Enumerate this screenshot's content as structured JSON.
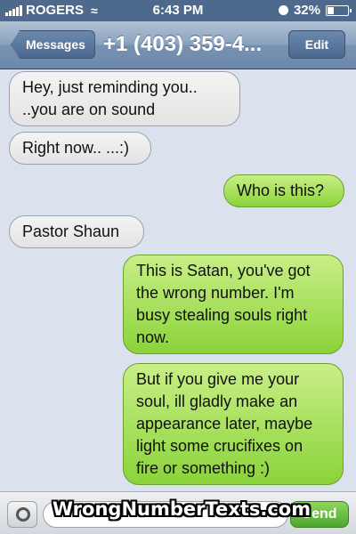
{
  "status_bar": {
    "carrier": "ROGERS",
    "time": "6:43 PM",
    "battery_text": "32%",
    "battery_level": 0.32,
    "signal_icon": "signal-bars-icon",
    "wifi_icon": "wifi-icon",
    "alarm_icon": "clock-icon"
  },
  "nav": {
    "back_label": "Messages",
    "title": "+1 (403) 359-4...",
    "edit_label": "Edit"
  },
  "messages": [
    {
      "direction": "in",
      "lines": [
        "Hey,  just reminding you..",
        "..you are on sound"
      ]
    },
    {
      "direction": "in",
      "lines": [
        "Right now.. ...:)"
      ]
    },
    {
      "direction": "out",
      "lines": [
        "Who is this?"
      ]
    },
    {
      "direction": "in",
      "lines": [
        "Pastor Shaun"
      ]
    },
    {
      "direction": "out",
      "lines": [
        "This is Satan, you've got",
        "the wrong number. I'm",
        "busy stealing souls right",
        "now."
      ]
    },
    {
      "direction": "out",
      "lines": [
        "But if you give me your",
        "soul, ill gladly make an",
        "appearance later, maybe",
        "light some crucifixes on",
        "fire or something :)"
      ]
    }
  ],
  "input_bar": {
    "send_label": "Send",
    "camera_icon": "camera-icon"
  },
  "watermark": "WrongNumberTexts.com",
  "colors": {
    "background": "#dbe2ed",
    "incoming_bubble": "#e8e8e8",
    "outgoing_bubble": "#a6e05a",
    "nav_bar": "#7791b2"
  }
}
